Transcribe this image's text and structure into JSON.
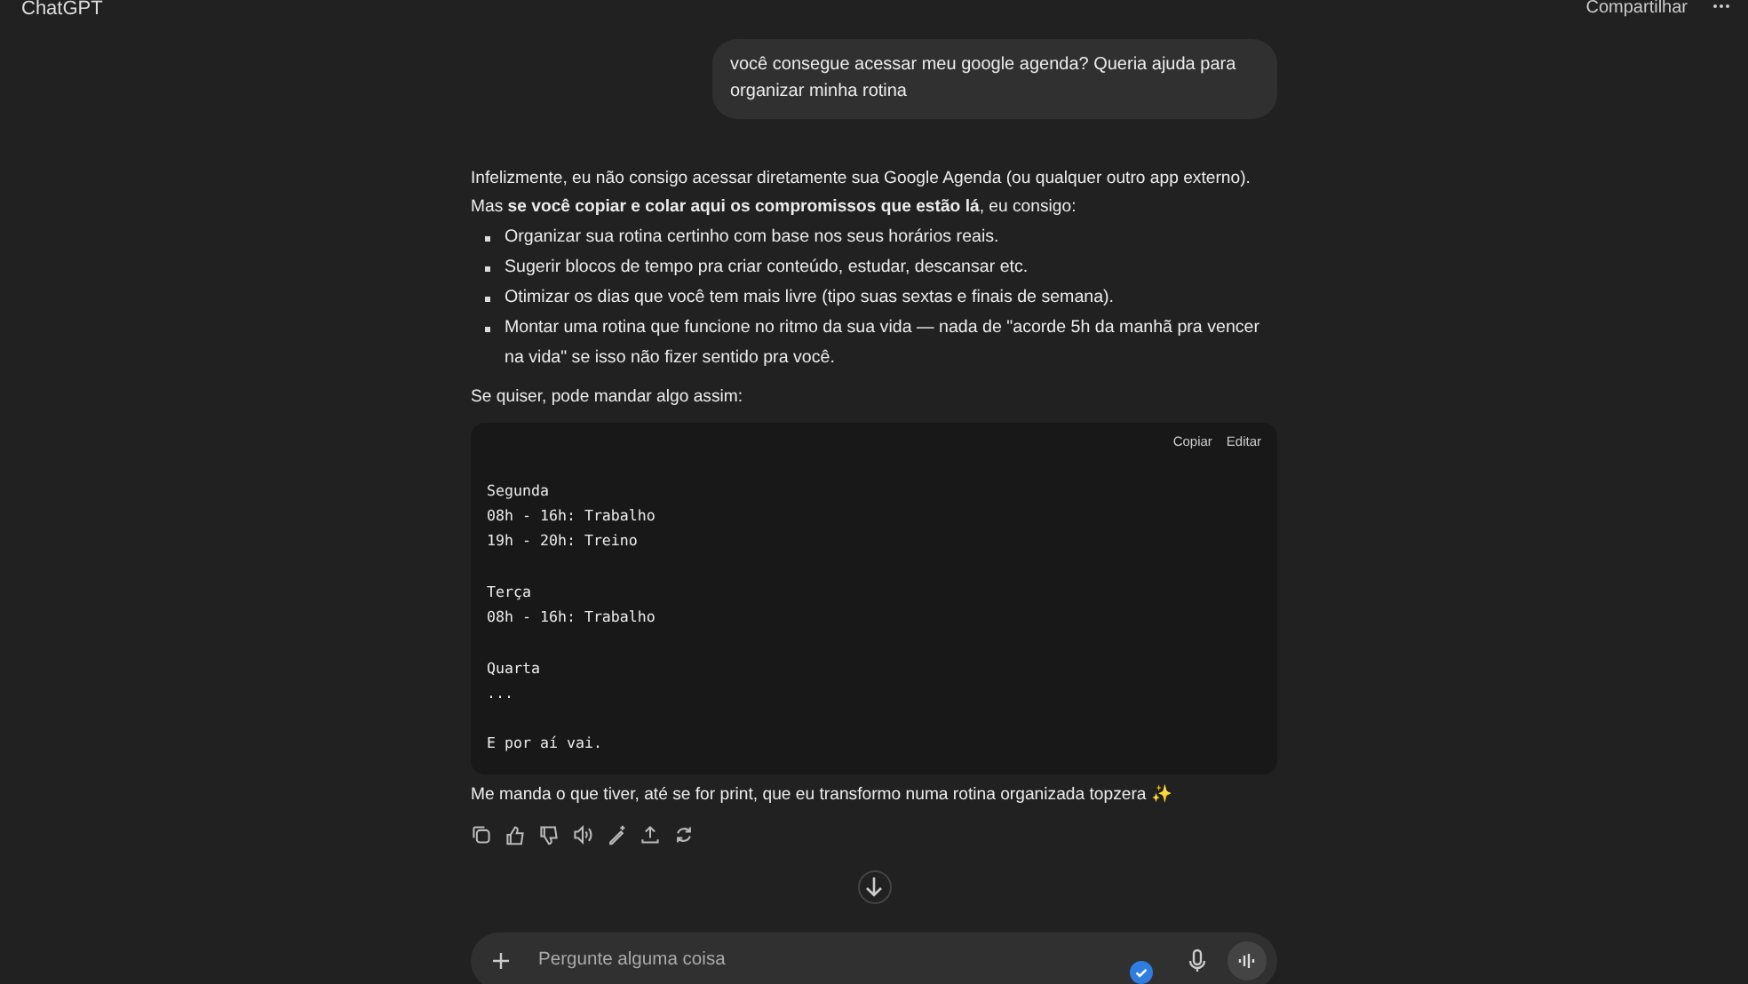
{
  "header": {
    "title": "ChatGPT",
    "share": "Compartilhar"
  },
  "user_message": "você consegue acessar meu google agenda? Queria ajuda para organizar minha rotina",
  "reply": {
    "intro": "Infelizmente, eu não consigo acessar diretamente sua Google Agenda (ou qualquer outro app externo). Mas **se você copiar e colar aqui os compromissos que estão lá**, eu consigo:",
    "bullets": [
      "Organizar sua rotina certinho com base nos seus horários reais.",
      "Sugerir blocos de tempo pra criar conteúdo, estudar, descansar etc.",
      "Otimizar os dias que você tem mais livre (tipo suas sextas e finais de semana).",
      "Montar uma rotina que funcione no ritmo da sua vida — nada de \"acorde 5h da manhã pra vencer na vida\" se isso não fizer sentido pra você."
    ],
    "lead": "Se quiser, pode mandar algo assim:",
    "code": {
      "copy": "Copiar",
      "edit": "Editar",
      "blocks": [
        [
          "Segunda",
          "08h - 16h: Trabalho",
          "19h - 20h: Treino"
        ],
        [
          "Terça",
          "08h - 16h: Trabalho"
        ],
        [
          "Quarta",
          "..."
        ],
        [
          "E por aí vai."
        ]
      ]
    },
    "closing": "Me manda o que tiver, até se for print, que eu transformo numa rotina organizada topzera ✨"
  },
  "composer": {
    "placeholder": "Pergunte alguma coisa"
  }
}
